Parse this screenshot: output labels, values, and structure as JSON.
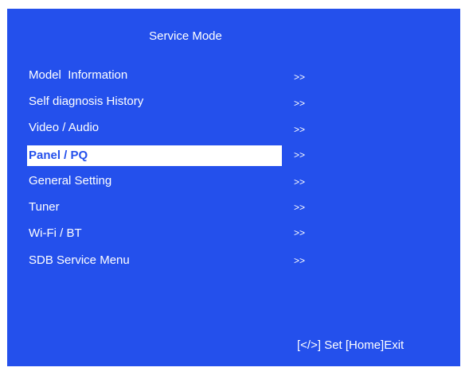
{
  "title": "Service Mode",
  "menu": [
    {
      "label": "Model  Information",
      "arrow": ">>",
      "selected": false
    },
    {
      "label": "Self diagnosis History",
      "arrow": ">>",
      "selected": false
    },
    {
      "label": "Video / Audio",
      "arrow": ">>",
      "selected": false
    },
    {
      "label": "Panel / PQ",
      "arrow": ">>",
      "selected": true
    },
    {
      "label": "General Setting",
      "arrow": ">>",
      "selected": false
    },
    {
      "label": "Tuner",
      "arrow": ">>",
      "selected": false
    },
    {
      "label": "Wi-Fi / BT",
      "arrow": ">>",
      "selected": false
    },
    {
      "label": "SDB Service Menu",
      "arrow": ">>",
      "selected": false
    }
  ],
  "footer": "[</>] Set [Home]Exit",
  "colors": {
    "background": "#2450ec",
    "text": "#ffffff",
    "selected_background": "#ffffff",
    "selected_text": "#2450ec"
  }
}
